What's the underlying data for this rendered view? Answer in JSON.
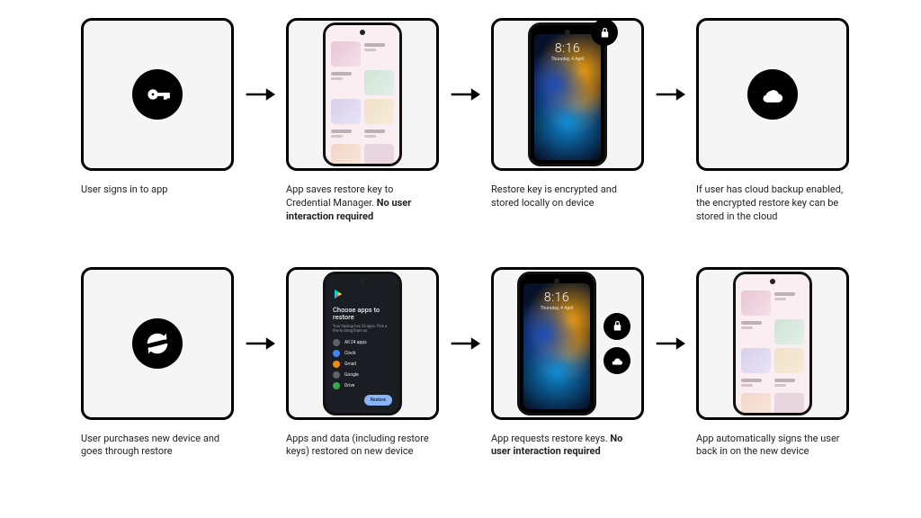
{
  "row1": {
    "step1": {
      "caption_plain": "User signs in to app"
    },
    "step2": {
      "caption_a": "App saves restore key to Credential Manager. ",
      "caption_b": "No user interaction required"
    },
    "step3": {
      "caption_plain": "Restore key is encrypted and stored locally on device"
    },
    "step4": {
      "caption_plain": "If user has cloud backup enabled, the encrypted restore key can be stored in the cloud"
    }
  },
  "row2": {
    "step1": {
      "caption_plain": "User purchases new device and goes through restore"
    },
    "step2": {
      "caption_plain": "Apps and data (including restore keys) restored on new device"
    },
    "step3": {
      "caption_a": "App requests restore keys. ",
      "caption_b": "No user interaction required"
    },
    "step4": {
      "caption_plain": "App automatically signs the user back in on the new device"
    }
  },
  "lockscreen": {
    "time": "8:16",
    "date": "Thursday, 4 April"
  },
  "restore_screen": {
    "title": "Choose apps to restore",
    "subtitle": "Your backup has 24 apps. Pick a few to bring them on.",
    "items": {
      "all": "All 24 apps",
      "a": "Clock",
      "b": "Gmail",
      "c": "Google",
      "d": "Drive"
    },
    "button": "Restore"
  }
}
